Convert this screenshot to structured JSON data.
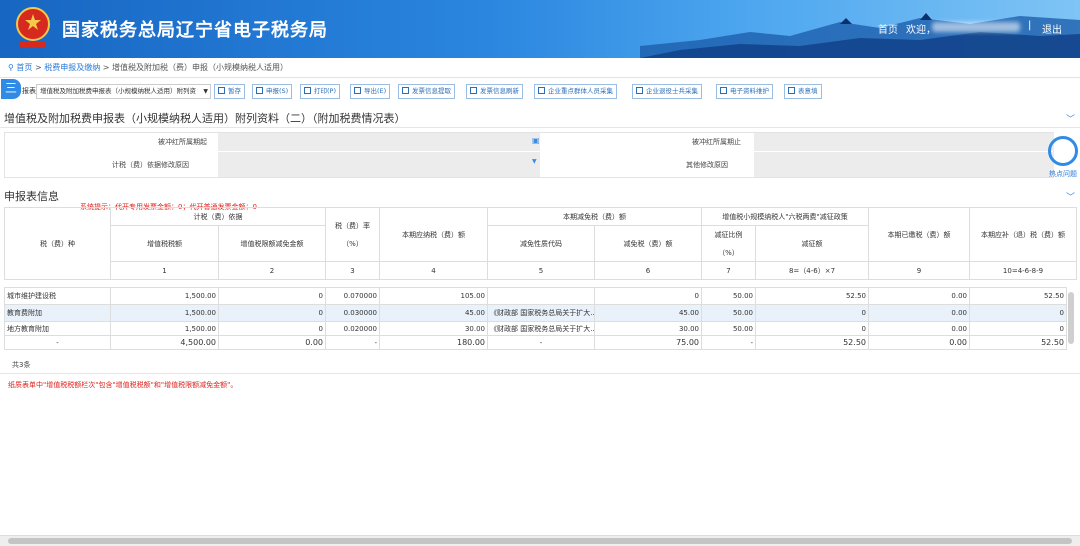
{
  "header": {
    "title": "国家税务总局辽宁省电子税务局",
    "home": "首页",
    "welcome": "欢迎，",
    "sep": "|",
    "logout": "退出"
  },
  "breadcrumb": {
    "home": "首页",
    "sep1": ">",
    "level1": "税费申报及缴纳",
    "sep2": ">",
    "current": "增值税及附加税（费）申报（小规模纳税人适用）"
  },
  "toolbar": {
    "menu_icon": "三",
    "label": "报表:",
    "form_select": "增值税及附加税费申报表（小规模纳税人适用）附列资",
    "buttons": [
      {
        "label": "暂存",
        "icon": "save-icon"
      },
      {
        "label": "申报(S)",
        "icon": "submit-icon"
      },
      {
        "label": "打印(P)",
        "icon": "print-icon"
      },
      {
        "label": "导出(E)",
        "icon": "export-icon"
      },
      {
        "label": "发票信息提取",
        "icon": "invoice-extract-icon"
      },
      {
        "label": "发票信息刷新",
        "icon": "refresh-icon"
      },
      {
        "label": "企业重点群体人员采集",
        "icon": "edit-icon"
      },
      {
        "label": "企业退役士兵采集",
        "icon": "edit-icon"
      },
      {
        "label": "电子资料维护",
        "icon": "edit-icon"
      },
      {
        "label": "表意填",
        "icon": "search-icon"
      }
    ]
  },
  "section1": {
    "title": "增值税及附加税费申报表（小规模纳税人适用）附列资料（二）（附加税费情况表）",
    "fields": {
      "period_start": "被冲红所属期起",
      "period_end": "被冲红所属期止",
      "basis_reason": "计税（费）依据修改原因",
      "other_reason": "其他修改原因"
    }
  },
  "float_help": {
    "label": "热点问题"
  },
  "section2": {
    "title": "申报表信息",
    "system_tip": "系统提示：代开专用发票金额：0；代开普通发票金额：0",
    "headers": {
      "tax_type": "税（费）种",
      "basis": "计税（费）依据",
      "vat_amount": "增值税税额",
      "vat_limit_reduce": "增值税限额减免金额",
      "rate": "税（费）率",
      "rate_unit": "（%）",
      "payable": "本期应纳税（费）额",
      "reduction": "本期减免税（费）额",
      "reduce_code": "减免性质代码",
      "reduce_amount": "减免税（费）额",
      "six_taxes": "增值税小规模纳税人\"六税两费\"减征政策",
      "reduce_ratio": "减征比例",
      "reduce_ratio_unit": "（%）",
      "reduce_sum": "减征额",
      "paid": "本期已缴税（费）额",
      "refund": "本期应补（退）税（费）额",
      "col_nums": [
        "1",
        "2",
        "3",
        "4",
        "5",
        "6",
        "7",
        "8=（4-6）×7",
        "9",
        "10=4-6-8-9"
      ]
    },
    "rows": [
      {
        "name": "城市维护建设税",
        "c1": "1,500.00",
        "c2": "0",
        "c3": "0.070000",
        "c4": "105.00",
        "c5": "",
        "c6": "0",
        "c7": "50.00",
        "c8": "52.50",
        "c9": "0.00",
        "c10": "52.50"
      },
      {
        "name": "教育费附加",
        "c1": "1,500.00",
        "c2": "0",
        "c3": "0.030000",
        "c4": "45.00",
        "c5": "《财政部 国家税务总局关于扩大...",
        "c6": "45.00",
        "c7": "50.00",
        "c8": "0",
        "c9": "0.00",
        "c10": "0"
      },
      {
        "name": "地方教育附加",
        "c1": "1,500.00",
        "c2": "0",
        "c3": "0.020000",
        "c4": "30.00",
        "c5": "《财政部 国家税务总局关于扩大...",
        "c6": "30.00",
        "c7": "50.00",
        "c8": "0",
        "c9": "0.00",
        "c10": "0"
      }
    ],
    "total": {
      "name": "-",
      "c1": "4,500.00",
      "c2": "0.00",
      "c3": "-",
      "c4": "180.00",
      "c5": "-",
      "c6": "75.00",
      "c7": "-",
      "c8": "52.50",
      "c9": "0.00",
      "c10": "52.50"
    },
    "count": "共3条",
    "footnote": "纸质表单中\"增值税税额栏次\"包含\"增值税税额\"和\"增值税限额减免金额\"。"
  }
}
